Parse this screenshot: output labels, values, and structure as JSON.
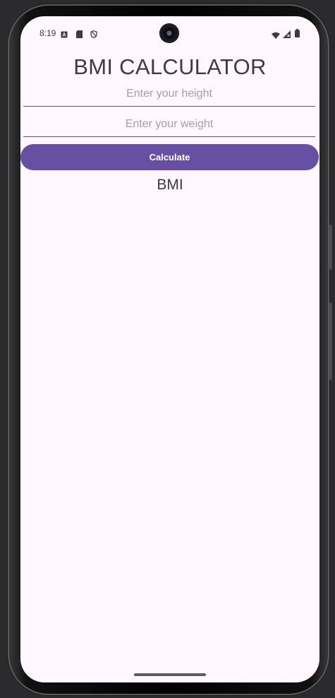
{
  "status_bar": {
    "time": "8:19",
    "left_icons": [
      "text-notification-icon",
      "sd-card-icon",
      "shield-icon"
    ],
    "right_icons": [
      "wifi-icon",
      "signal-icon",
      "battery-icon"
    ]
  },
  "app": {
    "title": "BMI CALCULATOR",
    "height_field": {
      "value": "",
      "placeholder": "Enter  your height"
    },
    "weight_field": {
      "value": "",
      "placeholder": "Enter your weight"
    },
    "calculate_label": "Calculate",
    "result_label": "BMI"
  },
  "colors": {
    "background": "#fef7fd",
    "accent": "#6750a4",
    "text": "#3c3b40",
    "placeholder": "#a3a1a6"
  }
}
